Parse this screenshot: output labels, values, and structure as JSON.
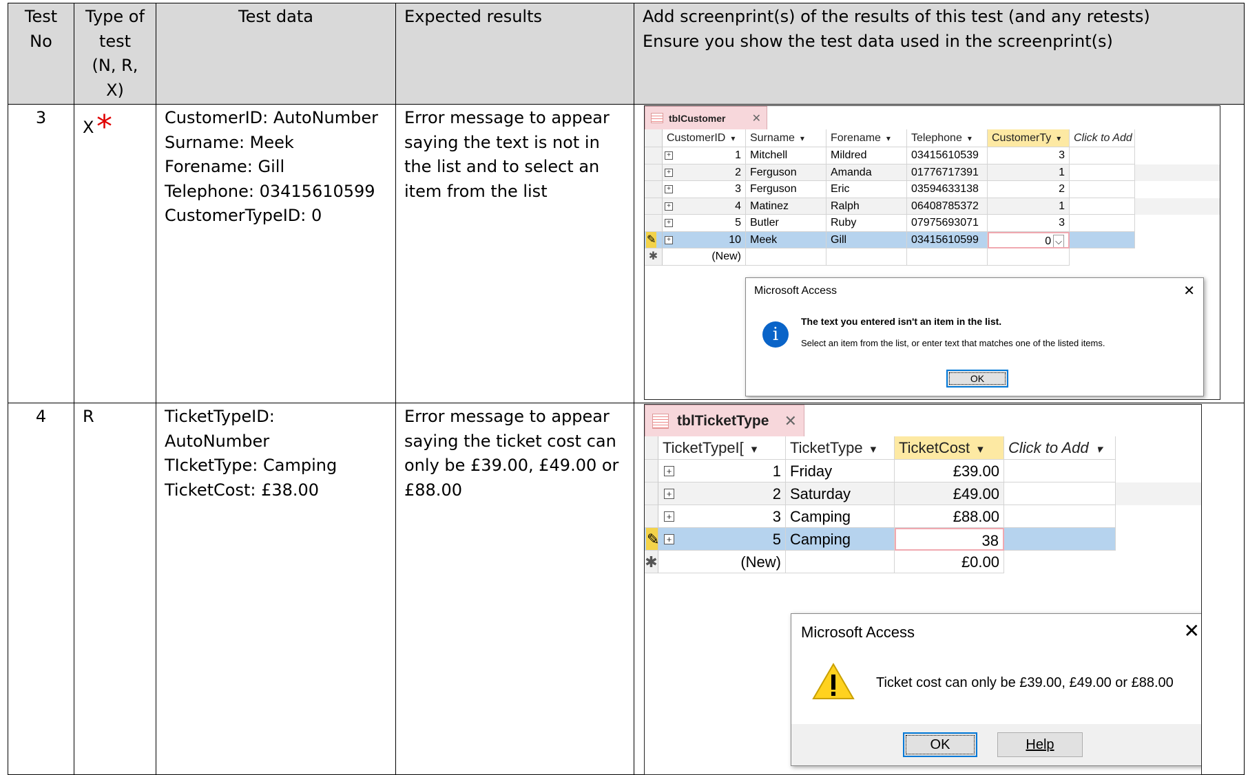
{
  "header": {
    "col_no": [
      "Test",
      "No"
    ],
    "col_type": [
      "Type of",
      "test",
      "(N, R,",
      "X)"
    ],
    "col_data": "Test data",
    "col_expected": "Expected results",
    "col_screenprint": [
      "Add screenprint(s) of the results of this test (and any retests)",
      "Ensure you show the test data used in the screenprint(s)"
    ]
  },
  "tests": [
    {
      "no": "3",
      "type": "X",
      "marker": "*",
      "data": [
        "CustomerID: AutoNumber",
        "Surname: Meek",
        "Forename: Gill",
        "Telephone: 03415610599",
        "CustomerTypeID: 0"
      ],
      "expected": [
        "Error message to appear",
        "saying the text is not in",
        "the list and to select an",
        "item from the list"
      ]
    },
    {
      "no": "4",
      "type": "R",
      "data": [
        "TicketTypeID:",
        "AutoNumber",
        "TIcketType: Camping",
        "TicketCost: £38.00"
      ],
      "expected": [
        "Error message to appear",
        "saying the ticket cost can",
        "only be £39.00, £49.00 or",
        "£88.00"
      ]
    }
  ],
  "shot1": {
    "tab_label": "tblCustomer",
    "close_glyph": "✕",
    "columns": [
      "CustomerID",
      "Surname",
      "Forename",
      "Telephone",
      "CustomerTy",
      "Click to Add"
    ],
    "sort_glyph": "▾",
    "rows": [
      [
        "1",
        "Mitchell",
        "Mildred",
        "03415610539",
        "3"
      ],
      [
        "2",
        "Ferguson",
        "Amanda",
        "01776717391",
        "1"
      ],
      [
        "3",
        "Ferguson",
        "Eric",
        "03594633138",
        "2"
      ],
      [
        "4",
        "Matinez",
        "Ralph",
        "06408785372",
        "1"
      ],
      [
        "5",
        "Butler",
        "Ruby",
        "07975693071",
        "3"
      ],
      [
        "10",
        "Meek",
        "Gill",
        "03415610599",
        "0"
      ]
    ],
    "new_label": "(New)",
    "dialog": {
      "title": "Microsoft Access",
      "close": "✕",
      "icon": "i",
      "message_bold": "The text you entered isn't an item in the list.",
      "message": "Select an item from the list, or enter text that matches one of the listed items.",
      "ok": "OK"
    }
  },
  "shot2": {
    "tab_label": "tblTicketType",
    "close_glyph": "✕",
    "columns": [
      "TicketTypeI[",
      "TicketType",
      "TicketCost",
      "Click to Add"
    ],
    "sort_glyph": "▾",
    "rows": [
      [
        "1",
        "Friday",
        "£39.00"
      ],
      [
        "2",
        "Saturday",
        "£49.00"
      ],
      [
        "3",
        "Camping",
        "£88.00"
      ],
      [
        "5",
        "Camping",
        "38"
      ]
    ],
    "new_row": [
      "(New)",
      "",
      "£0.00"
    ],
    "dialog": {
      "title": "Microsoft Access",
      "close": "✕",
      "icon": "!",
      "message": "Ticket cost can only be £39.00, £49.00 or £88.00",
      "ok": "OK",
      "help": "Help"
    }
  },
  "colors": {
    "header_bg": "#d9d9d9",
    "marker": "#e00000",
    "selected_row": "#b6d3ee",
    "active_column": "#fde9a3",
    "tab_bg": "#f7d7db",
    "info_icon": "#0a64c8",
    "warning_icon": "#ffd21f"
  }
}
